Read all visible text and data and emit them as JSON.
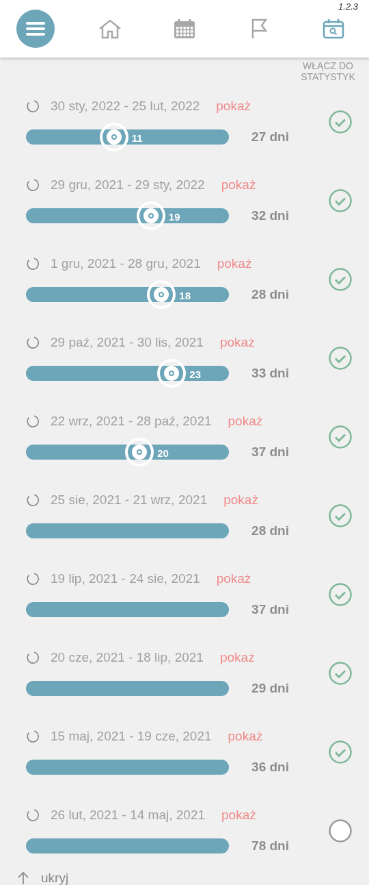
{
  "version": "1.2.3",
  "nav": [
    {
      "kind": "home",
      "selected": false
    },
    {
      "kind": "calendar",
      "selected": false
    },
    {
      "kind": "flag",
      "selected": false
    },
    {
      "kind": "calendar-search",
      "selected": true
    }
  ],
  "column_label": "WŁĄCZ DO STATYSTYK",
  "cycles": [
    {
      "range": "30 sty, 2022 - 25 lut, 2022",
      "link": "pokaż",
      "marker": {
        "day": "11"
      },
      "length": "27 dni",
      "included": true
    },
    {
      "range": "29 gru, 2021 - 29 sty, 2022",
      "link": "pokaż",
      "marker": {
        "day": "19"
      },
      "length": "32 dni",
      "included": true
    },
    {
      "range": "1 gru, 2021 - 28 gru, 2021",
      "link": "pokaż",
      "marker": {
        "day": "18"
      },
      "length": "28 dni",
      "included": true
    },
    {
      "range": "29 paź, 2021 - 30 lis, 2021",
      "link": "pokaż",
      "marker": {
        "day": "23"
      },
      "length": "33 dni",
      "included": true
    },
    {
      "range": "22 wrz, 2021 - 28 paź, 2021",
      "link": "pokaż",
      "marker": {
        "day": "20"
      },
      "length": "37 dni",
      "included": true
    },
    {
      "range": "25 sie, 2021 - 21 wrz, 2021",
      "link": "pokaż",
      "length": "28 dni",
      "included": true
    },
    {
      "range": "19 lip, 2021 - 24 sie, 2021",
      "link": "pokaż",
      "length": "37 dni",
      "included": true
    },
    {
      "range": "20 cze, 2021 - 18 lip, 2021",
      "link": "pokaż",
      "length": "29 dni",
      "included": true
    },
    {
      "range": "15 maj, 2021 - 19 cze, 2021",
      "link": "pokaż",
      "length": "36 dni",
      "included": true
    },
    {
      "range": "26 lut, 2021 - 14 maj, 2021",
      "link": "pokaż",
      "length": "78 dni",
      "included": false
    }
  ],
  "footer_link": "ukryj"
}
